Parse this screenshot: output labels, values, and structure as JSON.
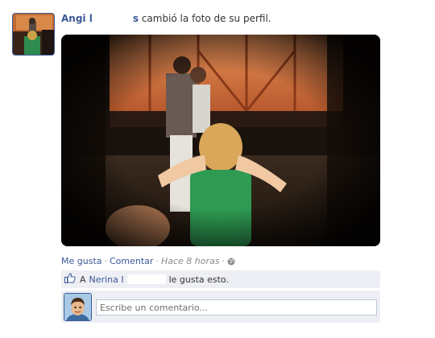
{
  "story": {
    "author_name": "Angi l",
    "author_name_tail": "s",
    "action_text": "cambió la foto de su perfil."
  },
  "actions": {
    "like_label": "Me gusta",
    "comment_label": "Comentar",
    "timestamp": "Hace 8 horas",
    "separator": "·",
    "privacy_icon": "globe-icon"
  },
  "likes": {
    "prefix": "A",
    "name": "Nerina I",
    "suffix": "le gusta esto.",
    "icon": "thumbs-up-icon"
  },
  "comment_box": {
    "placeholder": "Escribe un comentario..."
  },
  "colors": {
    "link": "#3b5998",
    "ufi_background": "#edeff4",
    "meta_text": "#8c8c8c"
  }
}
